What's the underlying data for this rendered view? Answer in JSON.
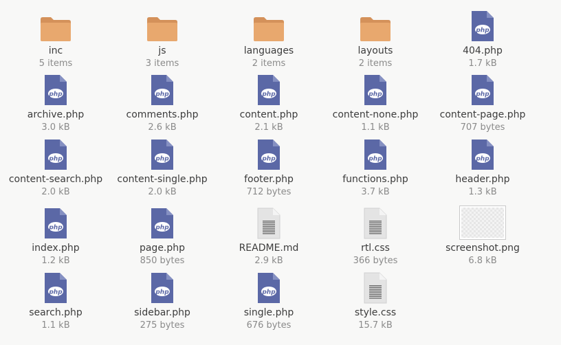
{
  "files": [
    {
      "name": "inc",
      "meta": "5 items",
      "type": "folder"
    },
    {
      "name": "js",
      "meta": "3 items",
      "type": "folder"
    },
    {
      "name": "languages",
      "meta": "2 items",
      "type": "folder"
    },
    {
      "name": "layouts",
      "meta": "2 items",
      "type": "folder"
    },
    {
      "name": "404.php",
      "meta": "1.7 kB",
      "type": "php"
    },
    {
      "name": "archive.php",
      "meta": "3.0 kB",
      "type": "php"
    },
    {
      "name": "comments.php",
      "meta": "2.6 kB",
      "type": "php"
    },
    {
      "name": "content.php",
      "meta": "2.1 kB",
      "type": "php"
    },
    {
      "name": "content-none.php",
      "meta": "1.1 kB",
      "type": "php"
    },
    {
      "name": "content-page.php",
      "meta": "707 bytes",
      "type": "php"
    },
    {
      "name": "content-search.php",
      "meta": "2.0 kB",
      "type": "php"
    },
    {
      "name": "content-single.php",
      "meta": "2.0 kB",
      "type": "php"
    },
    {
      "name": "footer.php",
      "meta": "712 bytes",
      "type": "php"
    },
    {
      "name": "functions.php",
      "meta": "3.7 kB",
      "type": "php"
    },
    {
      "name": "header.php",
      "meta": "1.3 kB",
      "type": "php"
    },
    {
      "name": "index.php",
      "meta": "1.2 kB",
      "type": "php"
    },
    {
      "name": "page.php",
      "meta": "850 bytes",
      "type": "php"
    },
    {
      "name": "README.md",
      "meta": "2.9 kB",
      "type": "text"
    },
    {
      "name": "rtl.css",
      "meta": "366 bytes",
      "type": "text"
    },
    {
      "name": "screenshot.png",
      "meta": "6.8 kB",
      "type": "image"
    },
    {
      "name": "search.php",
      "meta": "1.1 kB",
      "type": "php"
    },
    {
      "name": "sidebar.php",
      "meta": "275 bytes",
      "type": "php"
    },
    {
      "name": "single.php",
      "meta": "676 bytes",
      "type": "php"
    },
    {
      "name": "style.css",
      "meta": "15.7 kB",
      "type": "text"
    }
  ],
  "icons": {
    "folder": "folder-icon",
    "php": "php-file-icon",
    "text": "text-file-icon",
    "image": "image-thumbnail-icon"
  },
  "colors": {
    "folder_body": "#e8a86e",
    "folder_top": "#d4915a",
    "php_page": "#5b68a6",
    "php_fold": "#8590c2",
    "php_badge_text": "#5b68a6",
    "text_page": "#e4e4e4",
    "text_lines": "#6d6d6d",
    "label": "#3c3c3c",
    "meta": "#8a8a8a",
    "background": "#f8f8f7"
  }
}
